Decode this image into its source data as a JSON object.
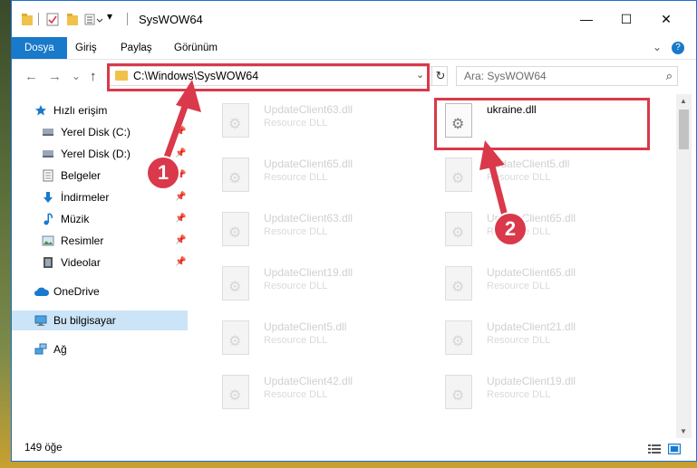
{
  "window": {
    "title": "SysWOW64",
    "controls": {
      "minimize": "—",
      "maximize": "☐",
      "close": "✕"
    }
  },
  "ribbon": {
    "tabs": [
      "Dosya",
      "Giriş",
      "Paylaş",
      "Görünüm"
    ],
    "active_tab": "Dosya",
    "expand_icon": "⌄",
    "help_icon": "?"
  },
  "address": {
    "back": "←",
    "forward": "→",
    "recent": "⌄",
    "up": "↑",
    "path": "C:\\Windows\\SysWOW64",
    "dropdown": "⌄",
    "refresh": "↻"
  },
  "search": {
    "placeholder": "Ara: SysWOW64",
    "icon": "⌕"
  },
  "nav": {
    "items": [
      {
        "label": "Hızlı erişim",
        "icon": "star-icon",
        "pinned": false
      },
      {
        "label": "Yerel Disk (C:)",
        "icon": "drive-icon",
        "pinned": true
      },
      {
        "label": "Yerel Disk (D:)",
        "icon": "drive-icon",
        "pinned": true
      },
      {
        "label": "Belgeler",
        "icon": "documents-icon",
        "pinned": true
      },
      {
        "label": "İndirmeler",
        "icon": "downloads-icon",
        "pinned": true
      },
      {
        "label": "Müzik",
        "icon": "music-icon",
        "pinned": true
      },
      {
        "label": "Resimler",
        "icon": "pictures-icon",
        "pinned": true
      },
      {
        "label": "Videolar",
        "icon": "videos-icon",
        "pinned": true
      },
      {
        "label": "OneDrive",
        "icon": "cloud-icon",
        "pinned": false
      },
      {
        "label": "Bu bilgisayar",
        "icon": "computer-icon",
        "pinned": false,
        "selected": true
      },
      {
        "label": "Ağ",
        "icon": "network-icon",
        "pinned": false
      }
    ],
    "pin_glyph": "📌"
  },
  "files": {
    "left": [
      {
        "name": "UpdateClient63.dll",
        "type": "Resource DLL"
      },
      {
        "name": "UpdateClient65.dll",
        "type": "Resource DLL"
      },
      {
        "name": "UpdateClient63.dll",
        "type": "Resource DLL"
      },
      {
        "name": "UpdateClient19.dll",
        "type": "Resource DLL"
      },
      {
        "name": "UpdateClient5.dll",
        "type": "Resource DLL"
      },
      {
        "name": "UpdateClient42.dll",
        "type": "Resource DLL"
      }
    ],
    "right": [
      {
        "name": "ukraine.dll",
        "type": "",
        "highlighted": true
      },
      {
        "name": "UpdateClient5.dll",
        "type": "Resource DLL"
      },
      {
        "name": "UpdateClient65.dll",
        "type": "Resource DLL"
      },
      {
        "name": "UpdateClient65.dll",
        "type": "Resource DLL"
      },
      {
        "name": "UpdateClient21.dll",
        "type": "Resource DLL"
      },
      {
        "name": "UpdateClient19.dll",
        "type": "Resource DLL"
      }
    ]
  },
  "status": {
    "count": "149 öğe"
  },
  "annotations": {
    "step1": "1",
    "step2": "2",
    "color": "#d9394a"
  }
}
